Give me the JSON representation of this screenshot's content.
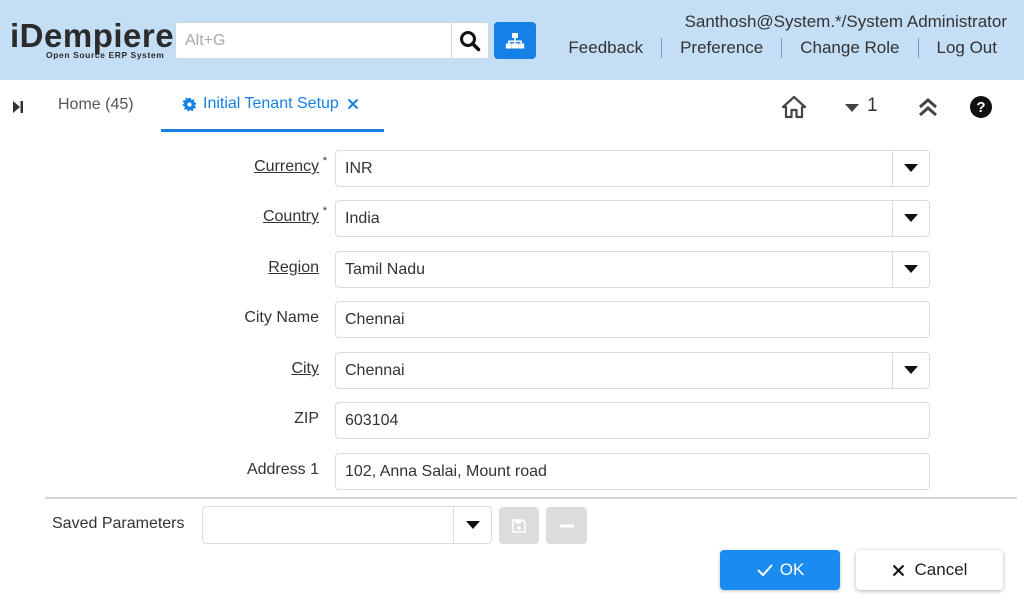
{
  "colors": {
    "header_bg": "#c4def6",
    "accent": "#1580e5",
    "ok_button": "#1a8bf0",
    "disabled_button": "#dcdcdc"
  },
  "header": {
    "logo_main": "iDempiere",
    "logo_sub": "Open Source ERP System",
    "search_placeholder": "Alt+G",
    "search_icon": "search-icon",
    "menu_tree_icon": "sitemap-icon",
    "user": "Santhosh@System.*/System Administrator",
    "links": {
      "feedback": "Feedback",
      "preference": "Preference",
      "change_role": "Change Role",
      "logout": "Log Out"
    }
  },
  "tabs": {
    "home": "Home (45)",
    "active": "Initial Tenant Setup",
    "window_count": "1"
  },
  "form": {
    "currency": {
      "label": "Currency",
      "required": "*",
      "value": "INR"
    },
    "country": {
      "label": "Country",
      "required": "*",
      "value": "India"
    },
    "region": {
      "label": "Region",
      "value": "Tamil Nadu"
    },
    "city_name": {
      "label": "City Name",
      "value": "Chennai"
    },
    "city": {
      "label": "City",
      "value": "Chennai"
    },
    "zip": {
      "label": "ZIP",
      "value": "603104"
    },
    "address1": {
      "label": "Address 1",
      "value": "102, Anna Salai, Mount road"
    }
  },
  "footer": {
    "saved_parameters_label": "Saved Parameters",
    "saved_parameters_value": "",
    "ok": "OK",
    "cancel": "Cancel"
  }
}
